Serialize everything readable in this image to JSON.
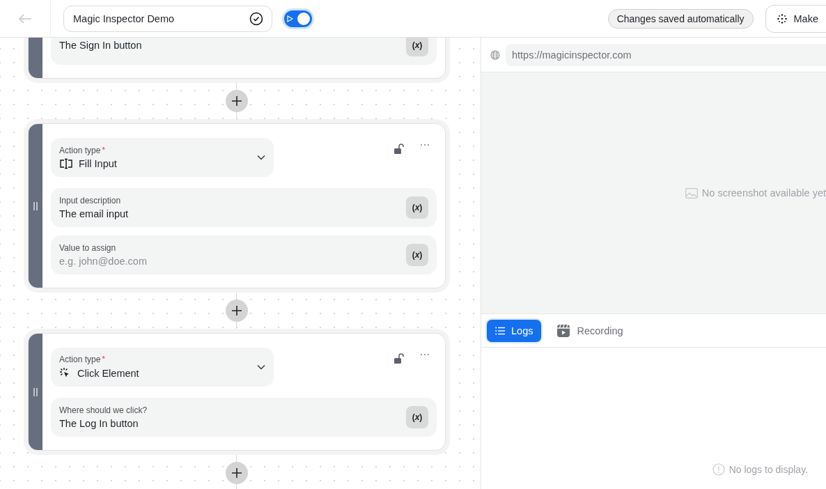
{
  "header": {
    "title": "Magic Inspector Demo",
    "toggle": {
      "on": true
    },
    "status": "Changes saved automatically",
    "make_button": "Make"
  },
  "steps": [
    {
      "kind": "partial",
      "fields": [
        {
          "value": "The Sign In button",
          "variable_button": "(*x*)"
        }
      ]
    },
    {
      "kind": "fill_input",
      "action": {
        "label": "Action type",
        "required_mark": "*",
        "value": "Fill Input"
      },
      "fields": [
        {
          "label": "Input description",
          "value": "The email input",
          "variable_button": "(*x*)"
        },
        {
          "label": "Value to assign",
          "placeholder": "e.g. john@doe.com",
          "variable_button": "(*x*)"
        }
      ]
    },
    {
      "kind": "click_element",
      "action": {
        "label": "Action type",
        "required_mark": "*",
        "value": "Click Element"
      },
      "fields": [
        {
          "label": "Where should we click?",
          "value": "The Log In button",
          "variable_button": "(*x*)"
        }
      ]
    }
  ],
  "browser": {
    "url": "https://magicinspector.com",
    "empty_message": "No screenshot available yet"
  },
  "tabs": [
    {
      "kind": "logs",
      "label": "Logs",
      "selected": true
    },
    {
      "kind": "recording",
      "label": "Recording",
      "selected": false
    }
  ],
  "logs_empty": "No logs to display."
}
